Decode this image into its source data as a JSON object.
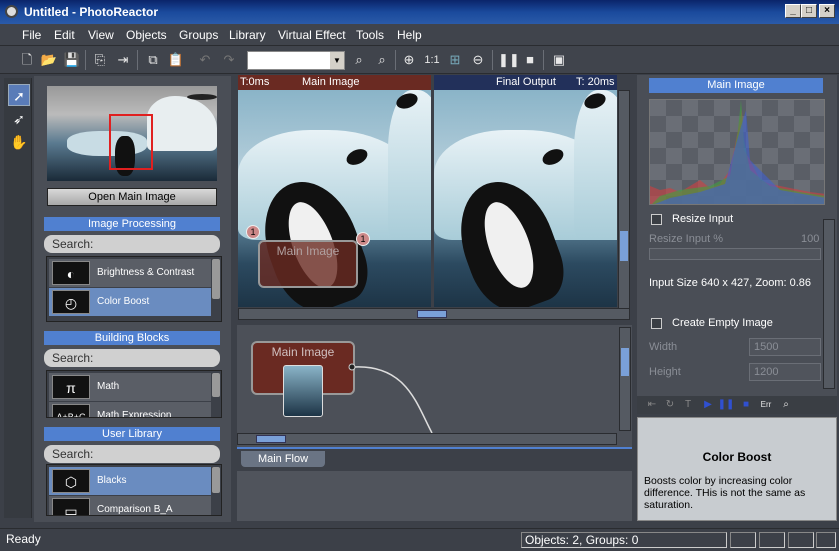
{
  "window": {
    "title": "Untitled - PhotoReactor"
  },
  "menu": [
    "File",
    "Edit",
    "View",
    "Objects",
    "Groups",
    "Library",
    "Virtual Effect",
    "Tools",
    "Help"
  ],
  "toolbar": {
    "zoom_label": "1:1"
  },
  "left": {
    "open_button": "Open Main Image",
    "sections": [
      {
        "header": "Image Processing",
        "search": "Search:",
        "items": [
          {
            "label": "Brightness & Contrast"
          },
          {
            "label": "Color Boost"
          }
        ]
      },
      {
        "header": "Building Blocks",
        "search": "Search:",
        "items": [
          {
            "label": "Math"
          },
          {
            "label": "Math Expression"
          }
        ]
      },
      {
        "header": "User Library",
        "search": "Search:",
        "items": [
          {
            "label": "Blacks"
          },
          {
            "label": "Comparison B_A"
          }
        ]
      }
    ]
  },
  "view_left": {
    "time": "T:0ms",
    "title": "Main Image"
  },
  "view_right": {
    "title": "Final Output",
    "time": "T: 20ms"
  },
  "node_main": {
    "title": "Main Image",
    "badge_left": "1",
    "badge_right": "1"
  },
  "flow": {
    "node_title": "Main Image",
    "tab": "Main Flow"
  },
  "right": {
    "header": "Main Image",
    "resize_input": "Resize Input",
    "resize_pct_label": "Resize Input %",
    "resize_pct_value": "100",
    "input_size": "Input Size 640 x 427, Zoom: 0.86",
    "create_empty": "Create Empty Image",
    "width_label": "Width",
    "width_value": "1500",
    "height_label": "Height",
    "height_value": "1200",
    "player_err": "Err"
  },
  "info": {
    "title": "Color Boost",
    "text": "Boosts color by increasing color difference. THis is not the same as saturation."
  },
  "status": {
    "left": "Ready",
    "objects": "Objects: 2, Groups: 0"
  },
  "colors": {
    "accent": "#5080d0",
    "node": "#6a2a22",
    "background": "#3c4048"
  }
}
